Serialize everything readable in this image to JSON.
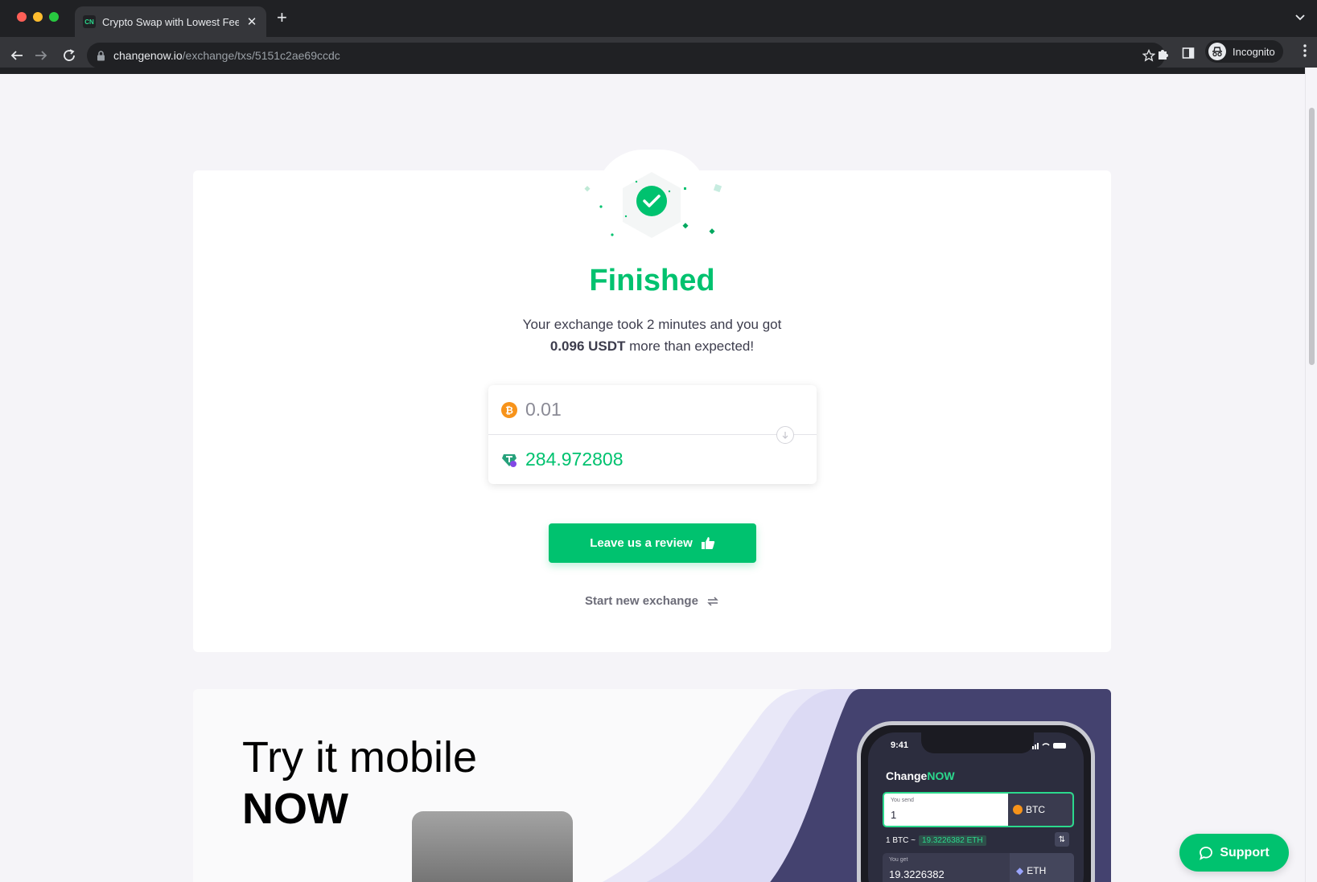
{
  "browser": {
    "tab_title": "Crypto Swap with Lowest Fees",
    "favicon_text": "CN",
    "url_host": "changenow.io",
    "url_path": "/exchange/txs/5151c2ae69ccdc",
    "profile_label": "Incognito"
  },
  "exchange": {
    "status_title": "Finished",
    "message_line1": "Your exchange took 2 minutes and you got",
    "bonus_amount": "0.096 USDT",
    "message_line2_rest": " more than expected!",
    "sent_amount": "0.01",
    "sent_coin_icon": "bitcoin-icon",
    "received_amount": "284.972808",
    "received_coin_icon": "tether-icon",
    "review_button": "Leave us a review",
    "new_exchange_link": "Start new exchange"
  },
  "promo": {
    "line1": "Try it mobile",
    "line2": "NOW",
    "phone": {
      "time": "9:41",
      "brand_part1": "Change",
      "brand_part2": "NOW",
      "send_label": "You send",
      "send_value": "1",
      "send_coin": "BTC",
      "rate_prefix": "1 BTC ~",
      "rate_value": "19.3226382 ETH",
      "get_label": "You get",
      "get_value": "19.3226382",
      "get_coin": "ETH"
    }
  },
  "support": {
    "label": "Support"
  },
  "colors": {
    "accent": "#00c26f",
    "bitcoin": "#f7931a",
    "tether": "#26a17b",
    "chrome_dark": "#202124"
  }
}
